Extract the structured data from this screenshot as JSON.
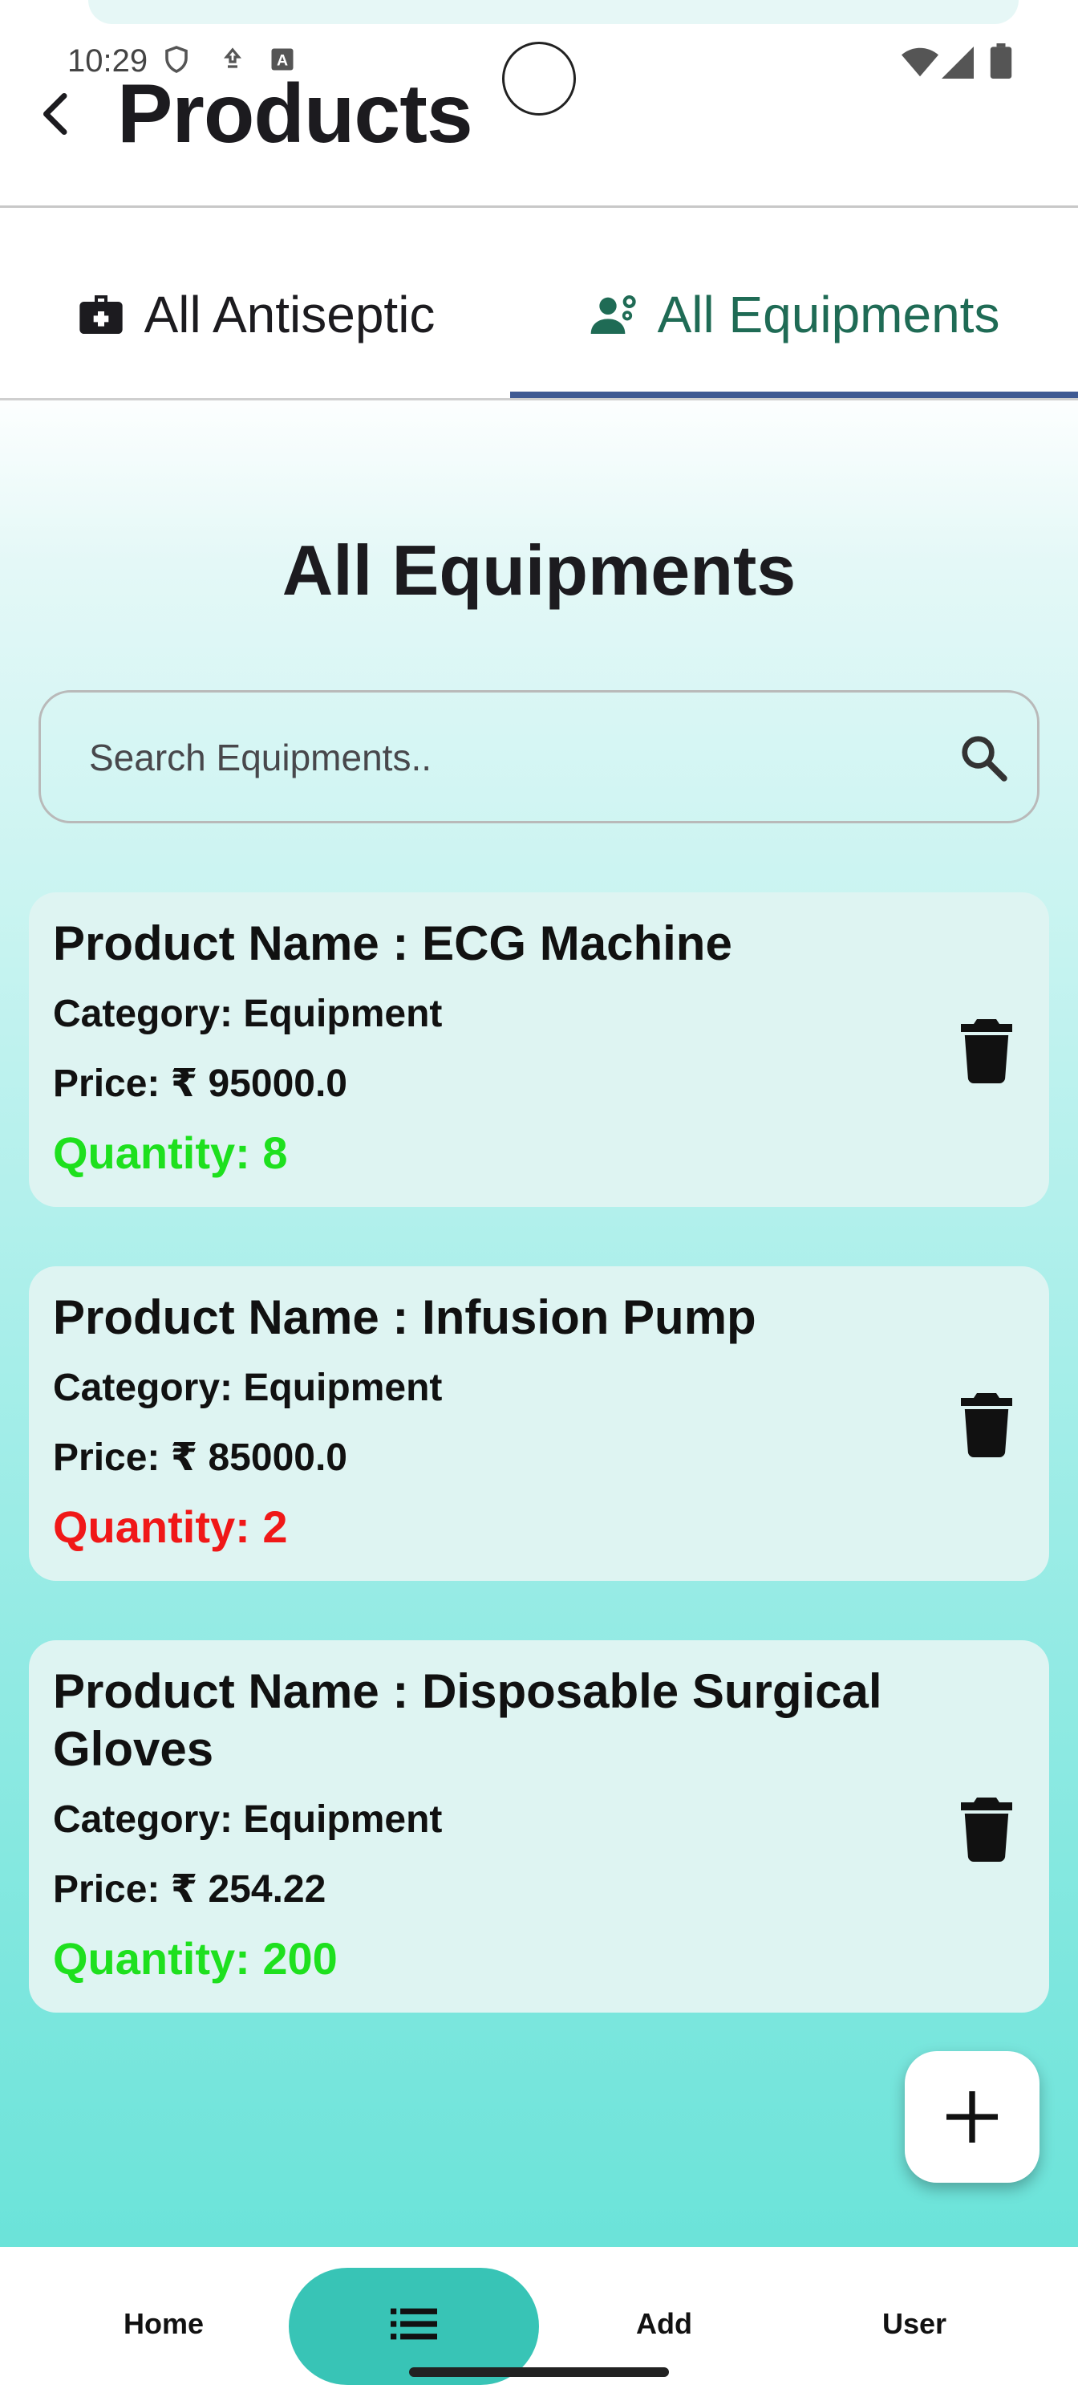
{
  "status_bar": {
    "time": "10:29"
  },
  "app_bar": {
    "title": "Products"
  },
  "tabs": [
    {
      "label": "All Antiseptic",
      "icon": "medical-kit-icon",
      "selected": false
    },
    {
      "label": "All Equipments",
      "icon": "medical-staff-icon",
      "selected": true
    }
  ],
  "section_title": "All Equipments",
  "search": {
    "placeholder": "Search Equipments..",
    "value": ""
  },
  "products": [
    {
      "name": "Product Name : ECG Machine",
      "category": "Category: Equipment",
      "price": "Price: ₹ 95000.0",
      "quantity": "Quantity: 8",
      "quantity_color": "#1ee01e"
    },
    {
      "name": "Product Name : Infusion Pump",
      "category": "Category: Equipment",
      "price": "Price: ₹ 85000.0",
      "quantity": "Quantity: 2",
      "quantity_color": "#f01818"
    },
    {
      "name_line1": "Product Name : Disposable Surgical",
      "name_line2": "Gloves",
      "category": "Category: Equipment",
      "price": "Price: ₹ 254.22",
      "quantity": "Quantity: 200",
      "quantity_color": "#1ee01e"
    }
  ],
  "bottom_nav": [
    {
      "label": "Home"
    },
    {
      "label": "",
      "icon": "list-icon",
      "selected": true
    },
    {
      "label": "Add"
    },
    {
      "label": "User"
    }
  ],
  "colors": {
    "tab_selected_text": "#1f6b55",
    "tab_indicator": "#3f5a93",
    "nav_pill": "#38c4b6",
    "card_bg": "#def4f2"
  }
}
